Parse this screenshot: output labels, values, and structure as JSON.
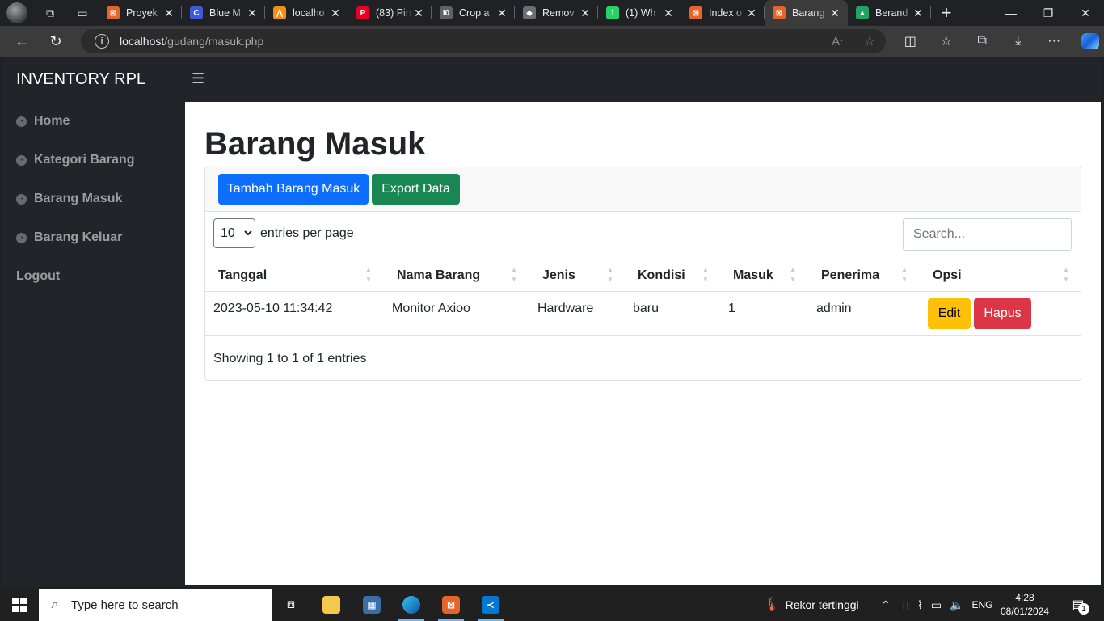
{
  "browser": {
    "tabs": [
      {
        "title": "Proyek",
        "icon": "xampp-icon",
        "color": "#e5642b",
        "glyph": "⊠"
      },
      {
        "title": "Blue M",
        "icon": "blue-c-icon",
        "color": "#3b5bdb",
        "glyph": "C"
      },
      {
        "title": "localho",
        "icon": "phpmyadmin-icon",
        "color": "#f29111",
        "glyph": "⋀"
      },
      {
        "title": "(83) Pin",
        "icon": "pinterest-icon",
        "color": "#e60023",
        "glyph": "P"
      },
      {
        "title": "Crop a",
        "icon": "crop-icon",
        "color": "#5f6368",
        "glyph": "I0"
      },
      {
        "title": "Remov",
        "icon": "layers-icon",
        "color": "#6b6f74",
        "glyph": "◆"
      },
      {
        "title": "(1) Wh",
        "icon": "whatsapp-icon",
        "color": "#25d366",
        "glyph": "1"
      },
      {
        "title": "Index o",
        "icon": "xampp-icon",
        "color": "#e5642b",
        "glyph": "⊠"
      },
      {
        "title": "Barang",
        "icon": "xampp-icon",
        "color": "#e5642b",
        "glyph": "⊠",
        "active": true
      },
      {
        "title": "Berand",
        "icon": "google-drive-icon",
        "color": "#1fa463",
        "glyph": "▲"
      }
    ],
    "url_host": "localhost",
    "url_path": "/gudang/masuk.php"
  },
  "app": {
    "brand": "INVENTORY RPL",
    "menu": {
      "home": "Home",
      "kategori": "Kategori Barang",
      "masuk": "Barang Masuk",
      "keluar": "Barang Keluar",
      "logout": "Logout"
    }
  },
  "page": {
    "title": "Barang Masuk",
    "btn_add": "Tambah Barang Masuk",
    "btn_export": "Export Data",
    "per_page_value": "10",
    "per_page_label": "entries per page",
    "search_placeholder": "Search...",
    "columns": [
      "Tanggal",
      "Nama Barang",
      "Jenis",
      "Kondisi",
      "Masuk",
      "Penerima",
      "Opsi"
    ],
    "rows": [
      {
        "tanggal": "2023-05-10 11:34:42",
        "nama": "Monitor Axioo",
        "jenis": "Hardware",
        "kondisi": "baru",
        "masuk": "1",
        "penerima": "admin",
        "edit": "Edit",
        "hapus": "Hapus"
      }
    ],
    "showing": "Showing 1 to 1 of 1 entries"
  },
  "taskbar": {
    "search_placeholder": "Type here to search",
    "weather": "Rekor tertinggi",
    "lang": "ENG",
    "time": "4:28",
    "date": "08/01/2024",
    "notifications": "1"
  }
}
